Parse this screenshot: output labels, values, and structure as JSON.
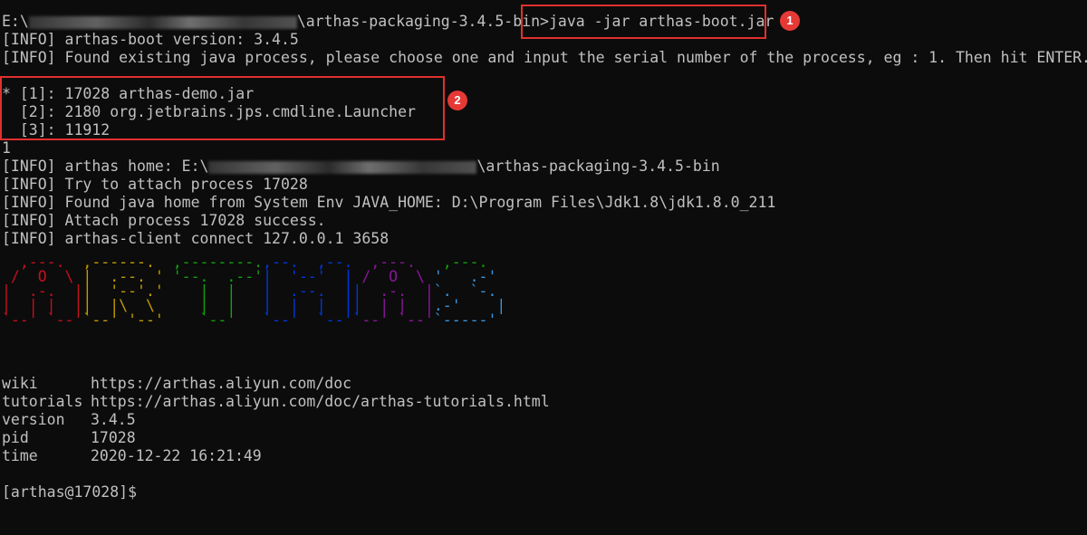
{
  "terminal": {
    "path_prefix": "E:\\",
    "path_suffix": "\\arthas-packaging-3.4.5-bin>",
    "command": "java -jar arthas-boot.jar",
    "info_lines_1": [
      "[INFO] arthas-boot version: 3.4.5",
      "[INFO] Found existing java process, please choose one and input the serial number of the process, eg : 1. Then hit ENTER."
    ],
    "processes": [
      "* [1]: 17028 arthas-demo.jar",
      "  [2]: 2180 org.jetbrains.jps.cmdline.Launcher",
      "  [3]: 11912"
    ],
    "user_input": "1",
    "home_prefix": "[INFO] arthas home: E:\\",
    "home_suffix": "\\arthas-packaging-3.4.5-bin",
    "info_lines_2": [
      "[INFO] Try to attach process 17028",
      "[INFO] Found java home from System Env JAVA_HOME: D:\\Program Files\\Jdk1.8\\jdk1.8.0_211",
      "[INFO] Attach process 17028 success.",
      "[INFO] arthas-client connect 127.0.0.1 3658"
    ],
    "logo_colors": [
      "#c50f1f",
      "#c19c00",
      "#13a10e",
      "#0037da",
      "#881798",
      "#13a10e",
      "#c50f1f",
      "#3a96dd",
      "#881798"
    ],
    "details": [
      {
        "key": "wiki",
        "value": "https://arthas.aliyun.com/doc"
      },
      {
        "key": "tutorials",
        "value": "https://arthas.aliyun.com/doc/arthas-tutorials.html"
      },
      {
        "key": "version",
        "value": "3.4.5"
      },
      {
        "key": "pid",
        "value": "17028"
      },
      {
        "key": "time",
        "value": "2020-12-22 16:21:49"
      }
    ],
    "prompt": "[arthas@17028]$"
  },
  "annotations": {
    "badge_1": "1",
    "badge_2": "2",
    "box_color": "#e0312e"
  }
}
